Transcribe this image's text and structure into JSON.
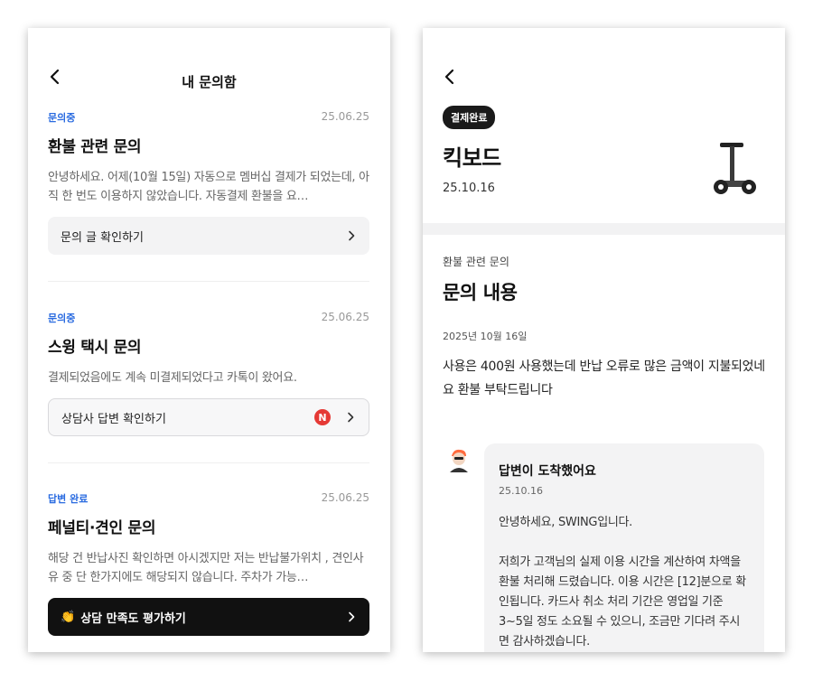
{
  "left": {
    "title": "내 문의함",
    "cards": [
      {
        "status": "문의중",
        "date": "25.06.25",
        "title": "환불 관련 문의",
        "body": "안녕하세요. 어제(10월 15일) 자동으로 멤버십 결제가 되었는데, 아직 한 번도 이용하지 않았습니다. 자동결제 환불을 요…",
        "button": "문의 글 확인하기"
      },
      {
        "status": "문의중",
        "date": "25.06.25",
        "title": "스윙 택시 문의",
        "body": "결제되었음에도 계속 미결제되었다고 카톡이 왔어요.",
        "button": "상담사 답변 확인하기",
        "badge": "N"
      },
      {
        "status": "답변 완료",
        "date": "25.06.25",
        "title": "페널티·견인 문의",
        "body": "해당 건 반납사진 확인하면 아시겠지만 저는 반납불가위치 , 견인사유 중 단 한가지에도 해당되지 않습니다. 주차가 가능…",
        "button": "상담 만족도 평가하기",
        "button_icon": "👏"
      }
    ]
  },
  "right": {
    "status_pill": "결제완료",
    "product_name": "킥보드",
    "product_date": "25.10.16",
    "product_icon": "kickboard-icon",
    "inquiry_category": "환불 관련 문의",
    "inquiry_heading": "문의 내용",
    "inquiry_date": "2025년 10월 16일",
    "inquiry_body": "사용은 400원 사용했는데 반납 오류로 많은 금액이 지불되었네요 환불 부탁드립니다",
    "reply": {
      "title": "답변이 도착했어요",
      "date": "25.10.16",
      "body": "안녕하세요, SWING입니다.\n\n저희가 고객님의 실제 이용 시간을 계산하여 차액을 환불 처리해 드렸습니다. 이용 시간은 [12]분으로 확인됩니다. 카드사 취소 처리 기간은 영업일 기준 3~5일 정도 소요될 수 있으니, 조금만 기다려 주시면 감사하겠습니다."
    }
  },
  "colors": {
    "accent": "#2a6be0",
    "badge": "#e53935",
    "dark_button": "#111111"
  }
}
